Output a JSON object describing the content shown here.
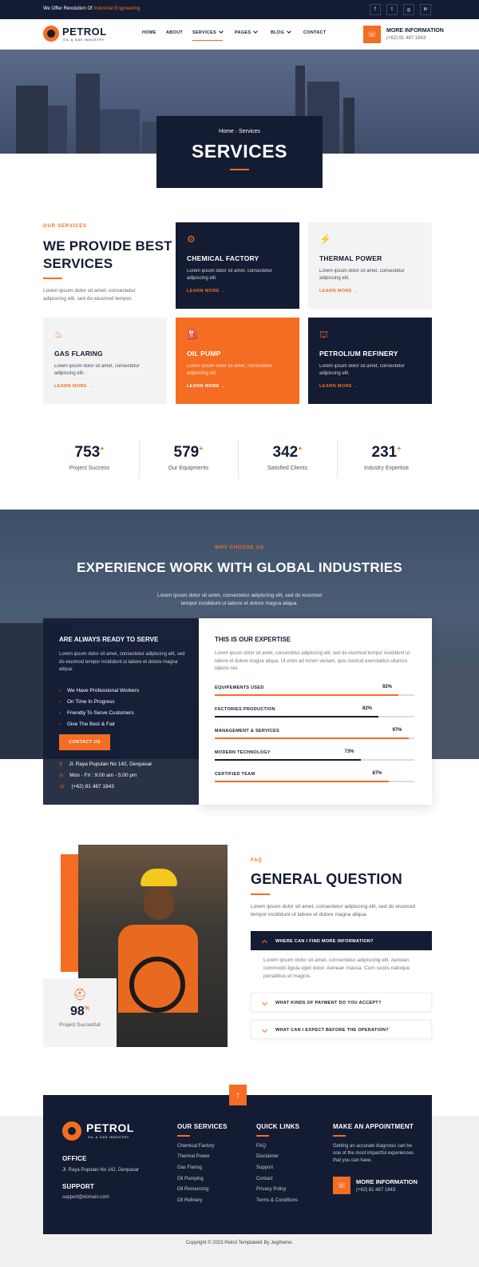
{
  "topbar": {
    "tagline_prefix": "We Offer Revolution Of",
    "tagline_highlight": "Industrial Engineering",
    "social": [
      {
        "icon": "facebook-icon",
        "glyph": "f"
      },
      {
        "icon": "twitter-icon",
        "glyph": "t"
      },
      {
        "icon": "instagram-icon",
        "glyph": "◎"
      },
      {
        "icon": "linkedin-icon",
        "glyph": "in"
      }
    ]
  },
  "brand": {
    "name": "PETROL",
    "tagline": "OIL & GAS INDUSTRY"
  },
  "nav": {
    "items": [
      "HOME",
      "ABOUT",
      "SERVICES",
      "PAGES",
      "BLOG",
      "CONTACT"
    ],
    "active": "SERVICES",
    "info_title": "MORE INFORMATION",
    "info_phone": "(+62) 81 487 1843"
  },
  "hero": {
    "breadcrumb_home": "Home",
    "breadcrumb_current": "Services",
    "title": "SERVICES"
  },
  "services": {
    "kicker": "OUR SERVICES",
    "heading_line1": "WE PROVIDE BEST",
    "heading_line2": "SERVICES",
    "desc": "Lorem ipsum dolor sit amet, consectetur adipiscing elit, sed do eiusmod tempor.",
    "cards": [
      {
        "title": "CHEMICAL FACTORY",
        "desc": "Lorem ipsum dolor sit amet, consectetur adipiscing elit.",
        "link": "LEARN MORE",
        "icon": "factory-icon"
      },
      {
        "title": "THERMAL POWER",
        "desc": "Lorem ipsum dolor sit amet, consectetur adipiscing elit.",
        "link": "LEARN MORE",
        "icon": "power-plant-icon"
      },
      {
        "title": "GAS FLARING",
        "desc": "Lorem ipsum dolor sit amet, consectetur adipiscing elit.",
        "link": "LEARN MORE",
        "icon": "gas-flaring-icon"
      },
      {
        "title": "OIL PUMP",
        "desc": "Lorem ipsum dolor sit amet, consectetur adipiscing elit.",
        "link": "LEARN MORE",
        "icon": "oil-pump-icon"
      },
      {
        "title": "PETROLIUM REFINERY",
        "desc": "Lorem ipsum dolor sit amet, consectetur adipiscing elit.",
        "link": "LEARN MORE",
        "icon": "refinery-icon"
      }
    ]
  },
  "stats": [
    {
      "value": "753",
      "label": "Project Success"
    },
    {
      "value": "579",
      "label": "Our Equipments"
    },
    {
      "value": "342",
      "label": "Satisfied Clients"
    },
    {
      "value": "231",
      "label": "Industry Expertise"
    }
  ],
  "stat_plus": "+",
  "why": {
    "kicker": "WHY CHOOSE US",
    "title": "EXPERIENCE WORK WITH GLOBAL INDUSTRIES",
    "desc_line1": "Lorem ipsum dolor sit amet, consectetur adipiscing elit, sed do eiusmod",
    "desc_line2": "tempor incididunt ut labore et dolore magna aliqua.",
    "left_title": "ARE ALWAYS READY TO SERVE",
    "left_desc": "Lorem ipsum dolor sit amet, consectetur adipiscing elit, sed do eiusmod tempor incididunt ut labore et dolore magna aliqua.",
    "checks": [
      "We Have Professional Workers",
      "On Time In Progress",
      "Friendly To Serve Customers",
      "Give The Best & Fair"
    ],
    "button": "CONTACT US",
    "contacts": [
      {
        "icon": "location-icon",
        "text": "Jl. Raya Puputan No 142, Denpasar"
      },
      {
        "icon": "clock-icon",
        "text": "Mon - Fri : 9:00 am - 5:00 pm"
      },
      {
        "icon": "phone-icon",
        "text": "(+62) 81 487 1843"
      }
    ],
    "right_title": "THIS IS OUR EXPERTISE",
    "right_desc": "Lorem ipsum dolor sit amet, consectetur adipiscing elit, sed do eiusmod tempor incididunt ut labore et dolore magna aliqua. Ut enim ad minim veniam, quis nostrud exercitation ullamco laboris nisi.",
    "bars": [
      {
        "label": "EQUIPEMENTS USED",
        "pct": "92%",
        "value": 0.92,
        "color": "#f46d22"
      },
      {
        "label": "FACTORIES PRODUCTION",
        "pct": "82%",
        "value": 0.82,
        "color": "#131c33"
      },
      {
        "label": "MANAGEMENT & SERVICES",
        "pct": "97%",
        "value": 0.97,
        "color": "#f46d22"
      },
      {
        "label": "MODERN TECHNOLOGY",
        "pct": "73%",
        "value": 0.73,
        "color": "#131c33"
      },
      {
        "label": "CERTIFIED TEAM",
        "pct": "87%",
        "value": 0.87,
        "color": "#f46d22"
      }
    ]
  },
  "faq": {
    "kicker": "FAQ",
    "title": "GENERAL QUESTION",
    "desc": "Lorem ipsum dolor sit amet, consectetur adipiscing elit, sed do eiusmod tempor incididunt ut labore et dolore magna aliqua.",
    "items": [
      {
        "q": "WHERE CAN I FIND MORE INFORMATION?",
        "a": "Lorem ipsum dolor sit amet, consectetur adipiscing elit. Aenean commodo ligula eget dolor. Aenean massa. Cum sociis natoque penatibus et magnis."
      },
      {
        "q": "WHAT KINDS OF PAYMENT DO YOU ACCEPT?"
      },
      {
        "q": "WHAT CAN I EXPECT BEFORE THE OPERATION?"
      }
    ],
    "badge_value": "98",
    "badge_unit": "%",
    "badge_label": "Project Succesfull"
  },
  "footer": {
    "office_title": "OFFICE",
    "office_addr": "Jl. Raya Puputan No 142, Denpasar",
    "support_title": "SUPPORT",
    "support_email": "support@domain.com",
    "col1_title": "OUR SERVICES",
    "col1": [
      "Chemical Factory",
      "Thermal Power",
      "Gas Flaring",
      "Oil Pumping",
      "Oil Resourcing",
      "Oil Refinery"
    ],
    "col2_title": "QUICK LINKS",
    "col2": [
      "FAQ",
      "Disclaimer",
      "Support",
      "Contact",
      "Privacy Policy",
      "Terms & Conditions"
    ],
    "col3_title": "MAKE AN APPOINTMENT",
    "col3_desc": "Getting an accurate diagnosis can be one of the most impactful experiences that you can have.",
    "info_title": "MORE INFORMATION",
    "info_phone": "(+62) 81 487 1843",
    "copyright": "Copyright © 2023 Petrol Templatekit By Jegtheme."
  },
  "colors": {
    "accent": "#f46d22",
    "navy": "#131c33"
  }
}
